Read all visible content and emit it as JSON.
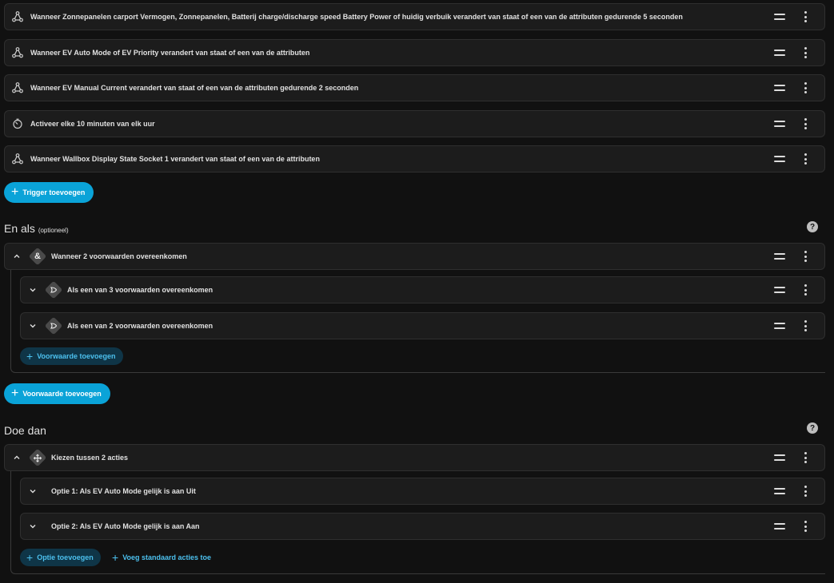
{
  "triggers": [
    {
      "label": "Wanneer Zonnepanelen carport Vermogen, Zonnepanelen, Batterij charge/discharge speed Battery Power of huidig verbuik verandert van staat of een van de attributen gedurende 5 seconden",
      "icon": "state-trigger-icon"
    },
    {
      "label": "Wanneer EV Auto Mode of EV Priority verandert van staat of een van de attributen",
      "icon": "state-trigger-icon"
    },
    {
      "label": "Wanneer EV Manual Current verandert van staat of een van de attributen gedurende 2 seconden",
      "icon": "state-trigger-icon"
    },
    {
      "label": "Activeer elke 10 minuten van elk uur",
      "icon": "timer-icon"
    },
    {
      "label": "Wanneer Wallbox Display State Socket 1 verandert van staat of een van de attributen",
      "icon": "state-trigger-icon"
    }
  ],
  "add_trigger_label": "Trigger toevoegen",
  "conditions_section": {
    "title": "En als",
    "subtitle": "(optioneel)",
    "group": {
      "label": "Wanneer 2 voorwaarden overeenkomen",
      "icon_glyph": "&"
    },
    "children": [
      {
        "label": "Als een van 3 voorwaarden overeenkomen"
      },
      {
        "label": "Als een van 2 voorwaarden overeenkomen"
      }
    ],
    "inner_add_label": "Voorwaarde toevoegen",
    "add_label": "Voorwaarde toevoegen"
  },
  "actions_section": {
    "title": "Doe dan",
    "group": {
      "label": "Kiezen tussen 2 acties"
    },
    "options": [
      {
        "label": "Optie 1: Als EV Auto Mode gelijk is aan Uit"
      },
      {
        "label": "Optie 2: Als EV Auto Mode gelijk is aan Aan"
      }
    ],
    "add_option_label": "Optie toevoegen",
    "add_default_label": "Voeg standaard acties toe"
  },
  "help_glyph": "?",
  "colors": {
    "accent": "#0aa3d8",
    "background": "#111111",
    "card": "#1c1c1c"
  }
}
